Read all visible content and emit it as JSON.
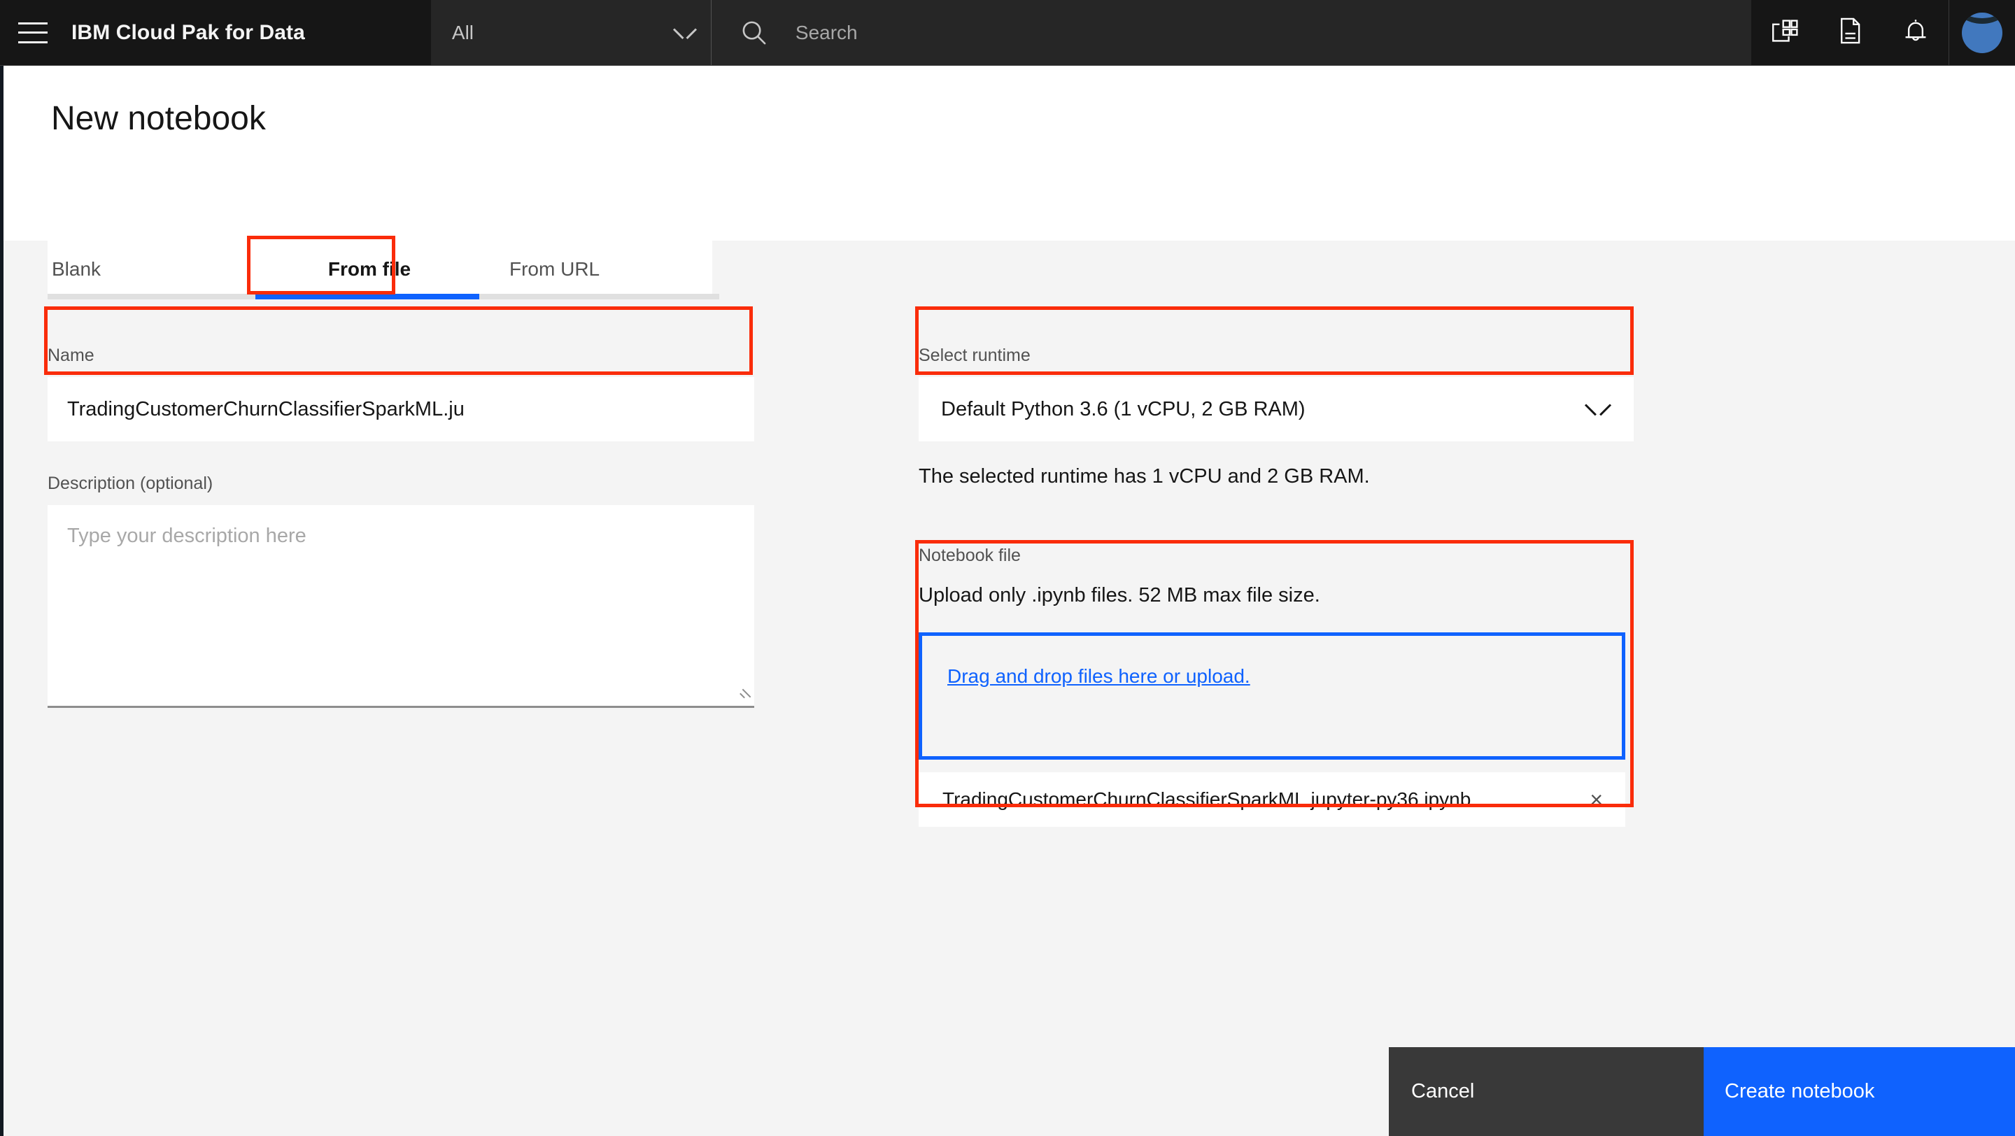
{
  "header": {
    "menu_icon": "hamburger-menu-icon",
    "brand_title": "IBM Cloud Pak for Data",
    "scope_value": "All",
    "scope_chevron_icon": "chevron-down-icon",
    "search_icon": "search-icon",
    "search_placeholder": "Search",
    "search_value": "",
    "icons": [
      {
        "name": "apps-grid-icon"
      },
      {
        "name": "document-icon"
      },
      {
        "name": "notification-bell-icon"
      }
    ],
    "avatar_label": "user-avatar"
  },
  "page": {
    "title": "New notebook"
  },
  "tabs": {
    "items": [
      {
        "label": "Blank",
        "selected": false
      },
      {
        "label": "From file",
        "selected": true
      },
      {
        "label": "From URL",
        "selected": false
      }
    ],
    "active_color": "#0f62fe",
    "inactive_color": "#e0e0e0"
  },
  "form": {
    "name": {
      "label": "Name",
      "value": "TradingCustomerChurnClassifierSparkML.ju"
    },
    "description": {
      "label": "Description (optional)",
      "value": "",
      "placeholder": "Type your description here"
    },
    "runtime": {
      "label": "Select runtime",
      "value": "Default Python 3.6 (1 vCPU, 2 GB RAM)",
      "chevron_icon": "chevron-down-icon",
      "helper_text": "The selected runtime has 1 vCPU and 2 GB RAM."
    },
    "notebook_file": {
      "label": "Notebook file",
      "upload_note": "Upload only .ipynb files. 52 MB max file size.",
      "dropzone_link": "Drag and drop files here or upload.",
      "uploaded": [
        {
          "name": "TradingCustomerChurnClassifierSparkML.jupyter-py36.ipynb",
          "remove_icon": "close-icon",
          "remove_glyph": "×"
        }
      ]
    }
  },
  "footer": {
    "cancel_label": "Cancel",
    "create_label": "Create notebook",
    "cancel_bg": "#393939",
    "create_bg": "#0f62fe"
  },
  "annotations": {
    "color": "#fa2c0a",
    "targets": [
      "from-file-tab",
      "name-input",
      "runtime-select",
      "file-upload-area",
      "create-notebook-button"
    ]
  }
}
